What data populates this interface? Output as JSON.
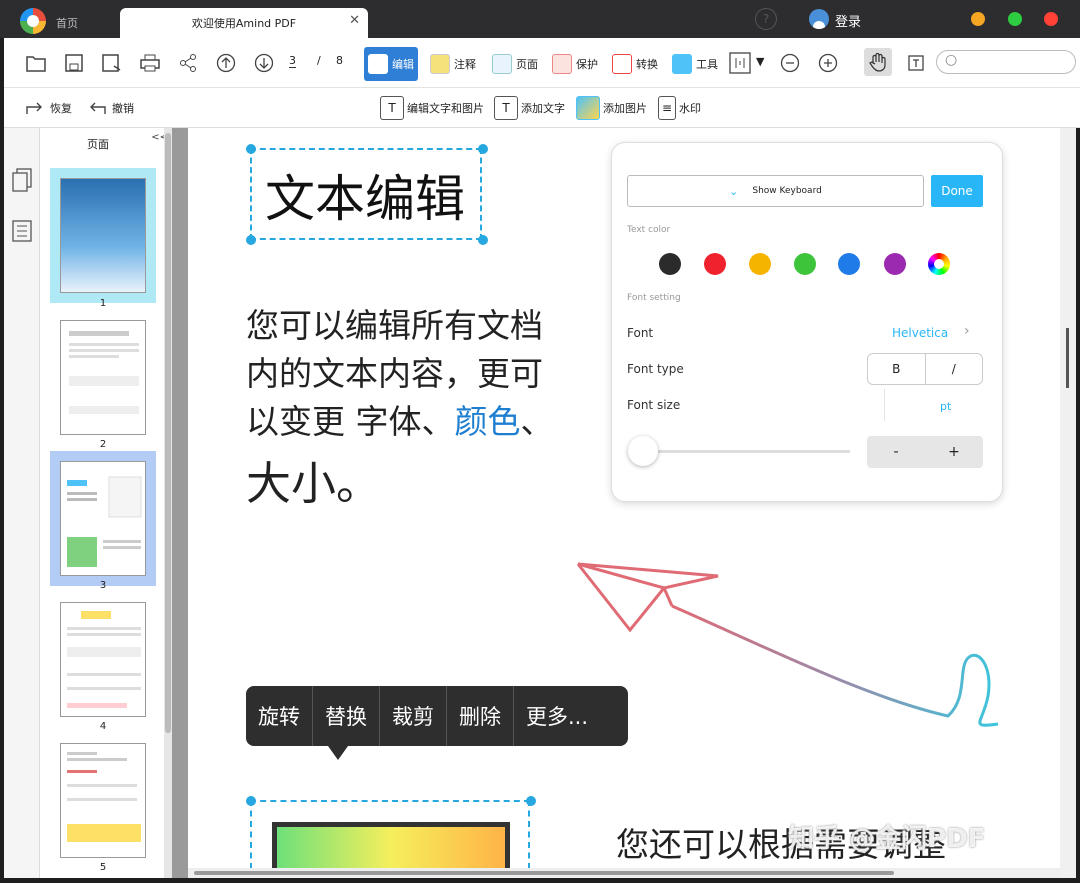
{
  "titlebar": {
    "home_tab": "首页",
    "doc_tab": "欢迎使用Amind PDF",
    "close_glyph": "✕",
    "help_glyph": "?",
    "login": "登录",
    "window_buttons": [
      "#f5a623",
      "#2ecc40",
      "#ff4136"
    ]
  },
  "toolbar": {
    "page_current": "3",
    "page_sep": "/",
    "page_total": "8",
    "modes": [
      "编辑",
      "注释",
      "页面",
      "保护",
      "转换",
      "工具"
    ],
    "search_placeholder": ""
  },
  "subtoolbar": {
    "redo": "恢复",
    "undo": "撤销",
    "edit_text_image": "编辑文字和图片",
    "add_text": "添加文字",
    "add_image": "添加图片",
    "watermark": "水印"
  },
  "thumbnails": {
    "title": "页面",
    "collapse": "<<",
    "pages": [
      "1",
      "2",
      "3",
      "4",
      "5"
    ],
    "selected": "3"
  },
  "page": {
    "heading": "文本编辑",
    "para_line1": "您可以编辑所有文档",
    "para_line2": "内的文本内容，更可",
    "para_line3_a": "以变更 字体、",
    "para_line3_b": "颜色",
    "para_line3_c": "、",
    "para_line4": "大小。",
    "bottom_text": "您还可以根据需要调整",
    "watermark": "知乎 @金闪PDF",
    "accent_color": "#1e7fd0"
  },
  "font_panel": {
    "show_keyboard": "Show Keyboard",
    "done": "Done",
    "text_color_label": "Text color",
    "colors": [
      "#2b2b2b",
      "#f0222e",
      "#f5b400",
      "#3ec43b",
      "#1e7be8",
      "#9c2ab0"
    ],
    "font_setting_label": "Font setting",
    "font_label": "Font",
    "font_value": "Helvetica",
    "font_type_label": "Font type",
    "bold": "B",
    "italic": "/",
    "font_size_label": "Font size",
    "unit": "pt",
    "minus": "-",
    "plus": "+"
  },
  "context_menu": [
    "旋转",
    "替换",
    "裁剪",
    "删除",
    "更多..."
  ]
}
